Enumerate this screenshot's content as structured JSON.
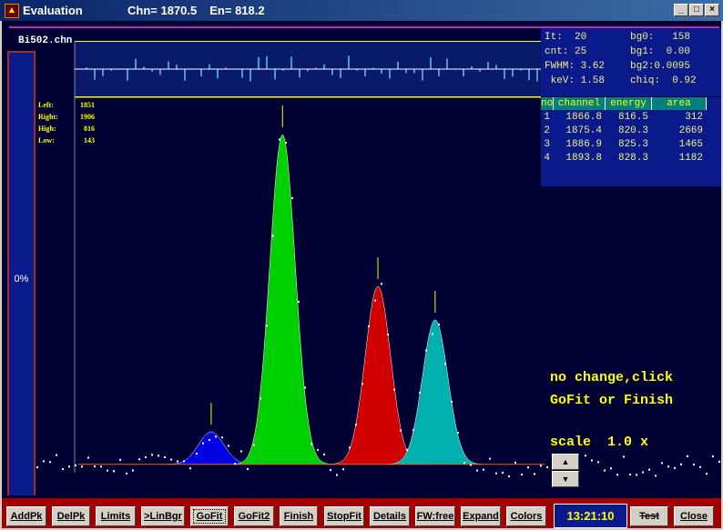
{
  "window": {
    "title": "Evaluation",
    "chn_readout": "Chn= 1870.5",
    "en_readout": "En= 818.2",
    "minimize": "_",
    "maximize": "□",
    "close": "×"
  },
  "file_name": "Bi502.chn",
  "progress_label": "0%",
  "fit_info": {
    "it": "It:  20",
    "cnt": "cnt: 25",
    "fwhm": "FWHM: 3.62",
    "kev": " keV: 1.58",
    "bg0": "bg0:   158",
    "bg1": "bg1:  0.00",
    "bg2": "bg2:0.0095",
    "chiq": "chiq:  0.92"
  },
  "limits": {
    "left_label": "Left:",
    "left": "1851",
    "right_label": "Right:",
    "right": "1906",
    "high_label": "High:",
    "high": "816",
    "low_label": "Low:",
    "low": "143"
  },
  "table": {
    "headers": [
      "no",
      "channel",
      "energy",
      "area"
    ],
    "rows": [
      [
        "1",
        "1866.8",
        "816.5",
        "312"
      ],
      [
        "2",
        "1875.4",
        "820.3",
        "2669"
      ],
      [
        "3",
        "1886.9",
        "825.3",
        "1465"
      ],
      [
        "4",
        "1893.8",
        "828.3",
        "1182"
      ]
    ]
  },
  "message": {
    "line1": "no change,click",
    "line2": "GoFit or Finish",
    "scale": "scale  1.0 x"
  },
  "spinner": {
    "up": "▲",
    "down": "▼"
  },
  "buttons": [
    "AddPk",
    "DelPk",
    "Limits",
    ">LinBgr",
    "GoFit",
    "GoFit2",
    "Finish",
    "StopFit",
    "Details",
    "FW:free",
    "Expand",
    "Colors",
    "Test",
    "Close"
  ],
  "clock": "13:21:10",
  "chart_data": {
    "type": "area",
    "xlim": [
      1851,
      1906
    ],
    "ylim": [
      143,
      816
    ],
    "background": 158,
    "fwhm": 3.62,
    "peaks": [
      {
        "channel": 1866.8,
        "height": 58,
        "color": "#0000e0"
      },
      {
        "channel": 1875.4,
        "height": 591,
        "color": "#00d000"
      },
      {
        "channel": 1886.9,
        "height": 319,
        "color": "#d00000"
      },
      {
        "channel": 1893.8,
        "height": 259,
        "color": "#00b0b0"
      }
    ]
  }
}
